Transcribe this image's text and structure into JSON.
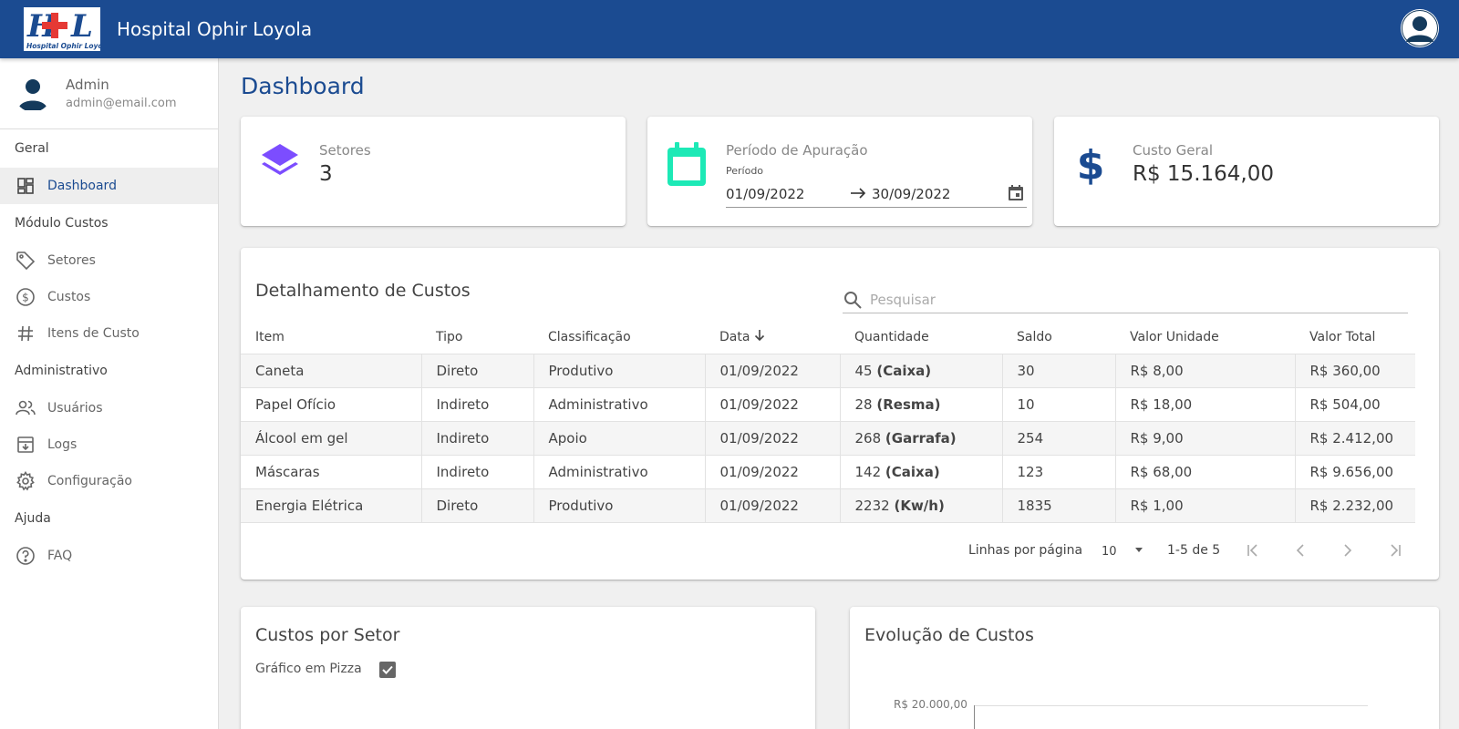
{
  "app": {
    "title": "Hospital Ophir Loyola",
    "logo_text": "Hospital Ophir Loyola",
    "logo_mark": "HOL"
  },
  "user": {
    "name": "Admin",
    "email": "admin@email.com"
  },
  "sidebar": {
    "sections": [
      {
        "label": "Geral"
      },
      {
        "label": "Módulo Custos"
      },
      {
        "label": "Administrativo"
      },
      {
        "label": "Ajuda"
      }
    ],
    "items": [
      {
        "label": "Dashboard",
        "icon": "dashboard-icon"
      },
      {
        "label": "Setores",
        "icon": "tag-icon"
      },
      {
        "label": "Custos",
        "icon": "dollar-circle-icon"
      },
      {
        "label": "Itens de Custo",
        "icon": "hash-icon"
      },
      {
        "label": "Usuários",
        "icon": "users-icon"
      },
      {
        "label": "Logs",
        "icon": "archive-icon"
      },
      {
        "label": "Configuração",
        "icon": "gear-icon"
      },
      {
        "label": "FAQ",
        "icon": "help-circle-icon"
      }
    ]
  },
  "page": {
    "title": "Dashboard"
  },
  "kpis": {
    "setores": {
      "label": "Setores",
      "value": "3",
      "icon": "layers-icon",
      "color": "#7c4dff"
    },
    "periodo": {
      "label": "Período de Apuração",
      "sublabel": "Período",
      "start": "01/09/2022",
      "end": "30/09/2022",
      "icon": "calendar-icon",
      "color": "#1de9b6"
    },
    "custo": {
      "label": "Custo Geral",
      "value": "R$ 15.164,00",
      "icon": "dollar-icon",
      "color": "#1b4b91"
    }
  },
  "table": {
    "title": "Detalhamento de Custos",
    "search_placeholder": "Pesquisar",
    "columns": [
      "Item",
      "Tipo",
      "Classificação",
      "Data",
      "Quantidade",
      "Saldo",
      "Valor Unidade",
      "Valor Total"
    ],
    "rows": [
      {
        "item": "Caneta",
        "tipo": "Direto",
        "classificacao": "Produtivo",
        "data": "01/09/2022",
        "qtd": "45",
        "unidade": "(Caixa)",
        "saldo": "30",
        "valor_unidade": "R$ 8,00",
        "valor_total": "R$ 360,00"
      },
      {
        "item": "Papel Ofício",
        "tipo": "Indireto",
        "classificacao": "Administrativo",
        "data": "01/09/2022",
        "qtd": "28",
        "unidade": "(Resma)",
        "saldo": "10",
        "valor_unidade": "R$ 18,00",
        "valor_total": "R$ 504,00"
      },
      {
        "item": "Álcool em gel",
        "tipo": "Indireto",
        "classificacao": "Apoio",
        "data": "01/09/2022",
        "qtd": "268",
        "unidade": "(Garrafa)",
        "saldo": "254",
        "valor_unidade": "R$ 9,00",
        "valor_total": "R$ 2.412,00"
      },
      {
        "item": "Máscaras",
        "tipo": "Indireto",
        "classificacao": "Administrativo",
        "data": "01/09/2022",
        "qtd": "142",
        "unidade": "(Caixa)",
        "saldo": "123",
        "valor_unidade": "R$ 68,00",
        "valor_total": "R$ 9.656,00"
      },
      {
        "item": "Energia Elétrica",
        "tipo": "Direto",
        "classificacao": "Produtivo",
        "data": "01/09/2022",
        "qtd": "2232",
        "unidade": "(Kw/h)",
        "saldo": "1835",
        "valor_unidade": "R$ 1,00",
        "valor_total": "R$ 2.232,00"
      }
    ],
    "pagination": {
      "rows_per_page_label": "Linhas por página",
      "rows_per_page": "10",
      "range": "1-5 de 5"
    }
  },
  "custos_por_setor": {
    "title": "Custos por Setor",
    "toggle_label": "Gráfico em Pizza",
    "toggle_checked": true
  },
  "evolucao": {
    "title": "Evolução de Custos",
    "y_tick_top": "R$ 20.000,00"
  }
}
